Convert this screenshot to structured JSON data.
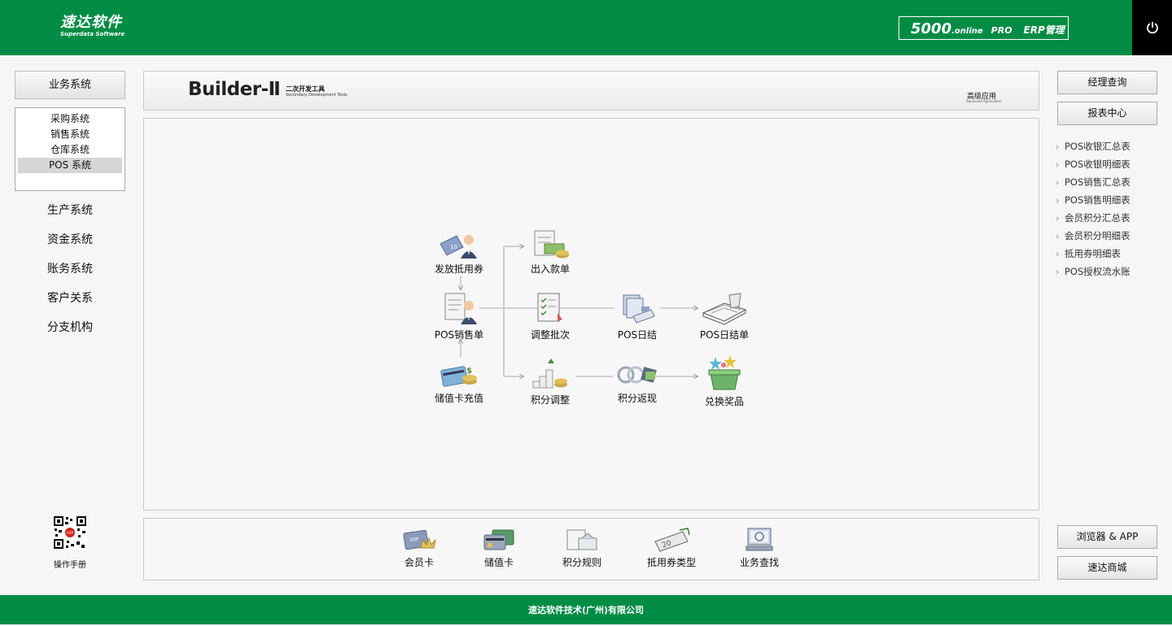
{
  "header": {
    "logo_main": "速达软件",
    "logo_sub": "Superdata Software",
    "product_version": "5000",
    "product_suffix": ".online",
    "product_edition": "PRO",
    "product_name": "ERP管理"
  },
  "left_nav": {
    "business_system": "业务系统",
    "sub_items": [
      "采购系统",
      "销售系统",
      "仓库系统",
      "POS 系统"
    ],
    "systems": [
      "生产系统",
      "资金系统",
      "账务系统",
      "客户关系",
      "分支机构"
    ],
    "manual_label": "操作手册"
  },
  "builder": {
    "title": "Builder-Ⅱ",
    "subtitle_cn": "二次开发工具",
    "subtitle_en": "Secondary Development Tools",
    "advanced_cn": "高级应用",
    "advanced_en": "Advanced Application"
  },
  "flow": {
    "issue_voucher": "发放抵用券",
    "pos_sales": "POS销售单",
    "card_recharge": "储值卡充值",
    "cash_in_out": "出入款单",
    "adjust_batch": "调整批次",
    "points_adjust": "积分调整",
    "pos_daily_close": "POS日结",
    "points_cashback": "积分返现",
    "pos_daily_close_sheet": "POS日结单",
    "redeem_prize": "兑换奖品"
  },
  "bottom_tools": [
    "会员卡",
    "储值卡",
    "积分规则",
    "抵用券类型",
    "业务查找"
  ],
  "right_panel": {
    "manager_query": "经理查询",
    "report_center": "报表中心",
    "reports": [
      "POS收银汇总表",
      "POS收银明细表",
      "POS销售汇总表",
      "POS销售明细表",
      "会员积分汇总表",
      "会员积分明细表",
      "抵用券明细表",
      "POS授权流水账"
    ],
    "browser_app": "浏览器 & APP",
    "mall": "速达商城"
  },
  "footer": {
    "company": "速达软件技术(广州)有限公司"
  },
  "colors": {
    "brand_green": "#008c45",
    "power_bg": "#000000"
  }
}
